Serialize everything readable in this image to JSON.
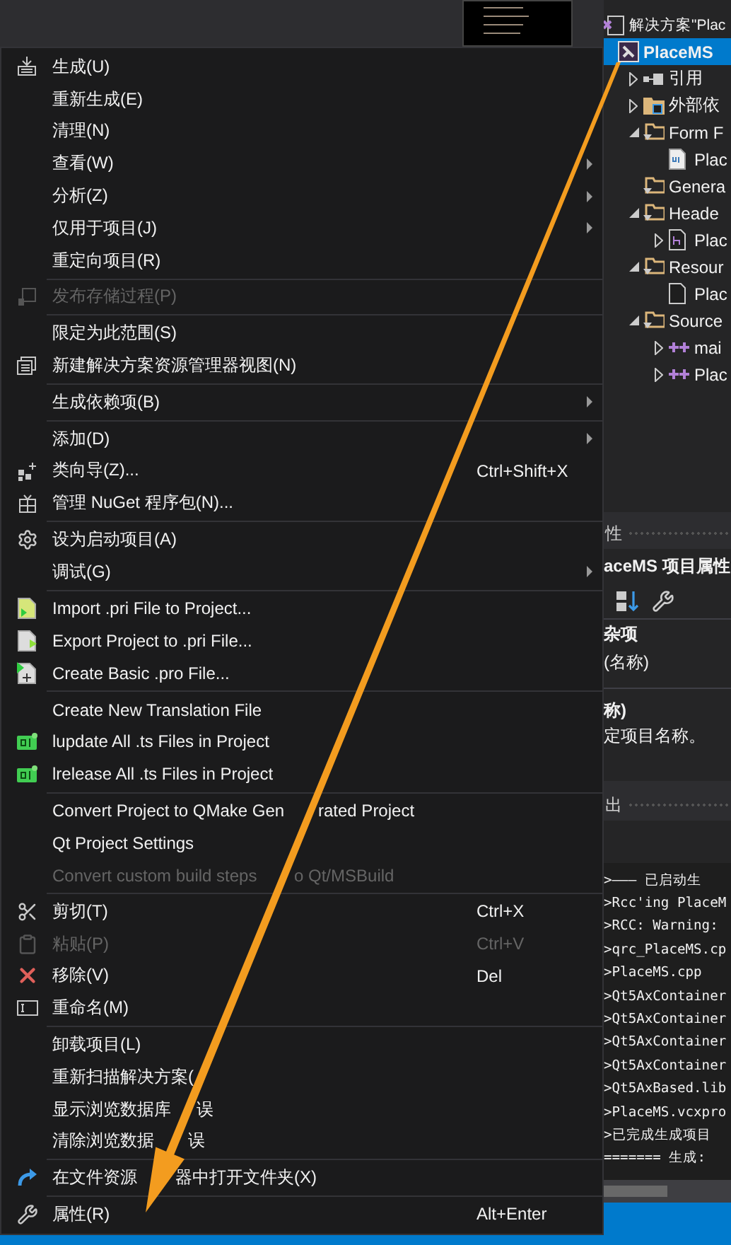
{
  "context_menu": [
    {
      "kind": "item",
      "label": "生成(U)",
      "submenu": false,
      "disabled": false
    },
    {
      "kind": "item",
      "label": "重新生成(E)",
      "submenu": false,
      "disabled": false
    },
    {
      "kind": "item",
      "label": "清理(N)",
      "submenu": false,
      "disabled": false
    },
    {
      "kind": "item",
      "label": "查看(W)",
      "submenu": true,
      "disabled": false
    },
    {
      "kind": "item",
      "label": "分析(Z)",
      "submenu": true,
      "disabled": false
    },
    {
      "kind": "item",
      "label": "仅用于项目(J)",
      "submenu": true,
      "disabled": false
    },
    {
      "kind": "item",
      "label": "重定向项目(R)",
      "submenu": false,
      "disabled": false
    },
    {
      "kind": "separator"
    },
    {
      "kind": "item",
      "label": "发布存储过程(P)",
      "submenu": false,
      "disabled": true
    },
    {
      "kind": "separator"
    },
    {
      "kind": "item",
      "label": "限定为此范围(S)",
      "submenu": false,
      "disabled": false
    },
    {
      "kind": "item",
      "label": "新建解决方案资源管理器视图(N)",
      "submenu": false,
      "disabled": false
    },
    {
      "kind": "separator"
    },
    {
      "kind": "item",
      "label": "生成依赖项(B)",
      "submenu": true,
      "disabled": false
    },
    {
      "kind": "separator"
    },
    {
      "kind": "item",
      "label": "添加(D)",
      "submenu": true,
      "disabled": false
    },
    {
      "kind": "item",
      "label": "类向导(Z)...",
      "shortcut": "Ctrl+Shift+X",
      "submenu": false,
      "disabled": false
    },
    {
      "kind": "item",
      "label": "管理 NuGet 程序包(N)...",
      "submenu": false,
      "disabled": false
    },
    {
      "kind": "separator"
    },
    {
      "kind": "item",
      "label": "设为启动项目(A)",
      "submenu": false,
      "disabled": false
    },
    {
      "kind": "item",
      "label": "调试(G)",
      "submenu": true,
      "disabled": false
    },
    {
      "kind": "separator"
    },
    {
      "kind": "item",
      "label": "Import .pri File to Project...",
      "submenu": false,
      "disabled": false
    },
    {
      "kind": "item",
      "label": "Export Project to .pri File...",
      "submenu": false,
      "disabled": false
    },
    {
      "kind": "item",
      "label": "Create Basic .pro File...",
      "submenu": false,
      "disabled": false
    },
    {
      "kind": "separator"
    },
    {
      "kind": "item",
      "label": "Create New Translation File",
      "submenu": false,
      "disabled": false
    },
    {
      "kind": "item",
      "label": "lupdate All .ts Files in Project",
      "submenu": false,
      "disabled": false
    },
    {
      "kind": "item",
      "label": "lrelease All .ts Files in Project",
      "submenu": false,
      "disabled": false
    },
    {
      "kind": "separator"
    },
    {
      "kind": "item",
      "label": "Convert Project to QMake Gen",
      "label_after": "rated Project",
      "submenu": false,
      "disabled": false
    },
    {
      "kind": "item",
      "label": "Qt Project Settings",
      "submenu": false,
      "disabled": false
    },
    {
      "kind": "item",
      "label": "Convert custom build steps",
      "label_after": "o Qt/MSBuild",
      "submenu": false,
      "disabled": true
    },
    {
      "kind": "separator"
    },
    {
      "kind": "item",
      "label": "剪切(T)",
      "shortcut": "Ctrl+X",
      "submenu": false,
      "disabled": false
    },
    {
      "kind": "item",
      "label": "粘贴(P)",
      "shortcut": "Ctrl+V",
      "submenu": false,
      "disabled": true
    },
    {
      "kind": "item",
      "label": "移除(V)",
      "shortcut": "Del",
      "submenu": false,
      "disabled": false
    },
    {
      "kind": "item",
      "label": "重命名(M)",
      "submenu": false,
      "disabled": false
    },
    {
      "kind": "separator"
    },
    {
      "kind": "item",
      "label": "卸载项目(L)",
      "submenu": false,
      "disabled": false
    },
    {
      "kind": "item",
      "label": "重新扫描解决方案(",
      "submenu": false,
      "disabled": false
    },
    {
      "kind": "item",
      "label": "显示浏览数据库",
      "label_after": "误",
      "submenu": false,
      "disabled": false
    },
    {
      "kind": "item",
      "label": "清除浏览数据",
      "label_after": "误",
      "submenu": false,
      "disabled": false
    },
    {
      "kind": "separator"
    },
    {
      "kind": "item",
      "label": "在文件资源",
      "label_after": "器中打开文件夹(X)",
      "submenu": false,
      "disabled": false
    },
    {
      "kind": "separator"
    },
    {
      "kind": "item",
      "label": "属性(R)",
      "shortcut": "Alt+Enter",
      "submenu": false,
      "disabled": false
    }
  ],
  "solution_explorer": {
    "solution": "解决方案\"Plac",
    "project": {
      "label": "PlaceMS",
      "selected": true
    },
    "nodes": [
      {
        "kind": "references",
        "label": "引用",
        "expanded": false
      },
      {
        "kind": "external",
        "label": "外部依",
        "expanded": false
      },
      {
        "kind": "filter",
        "label": "Form F",
        "expanded": true,
        "children": [
          {
            "kind": "ui",
            "label": "Plac"
          }
        ]
      },
      {
        "kind": "filter",
        "label": "Genera"
      },
      {
        "kind": "filter",
        "label": "Heade",
        "expanded": true,
        "children": [
          {
            "kind": "header",
            "label": "Plac",
            "expanded": false
          }
        ]
      },
      {
        "kind": "filter",
        "label": "Resour",
        "expanded": true,
        "children": [
          {
            "kind": "file",
            "label": "Plac"
          }
        ]
      },
      {
        "kind": "filter",
        "label": "Source",
        "expanded": true,
        "children": [
          {
            "kind": "source",
            "label": "mai",
            "expanded": false
          },
          {
            "kind": "source",
            "label": "Plac",
            "expanded": false
          }
        ]
      }
    ]
  },
  "properties": {
    "title": "性",
    "object": "aceMS 项目属性",
    "category": "杂项",
    "rows": [
      "(名称)"
    ],
    "description_title": "称)",
    "description": "定项目名称。"
  },
  "output": {
    "title": "出",
    "lines": [
      ">——— 已启动生",
      ">Rcc'ing PlaceM",
      ">RCC: Warning:",
      ">qrc_PlaceMS.cp",
      ">PlaceMS.cpp",
      ">Qt5AxContainer",
      ">Qt5AxContainer",
      ">Qt5AxContainer",
      ">Qt5AxContainer",
      ">Qt5AxBased.lib",
      ">PlaceMS.vcxpro",
      ">已完成生成项目",
      "======= 生成:"
    ]
  }
}
